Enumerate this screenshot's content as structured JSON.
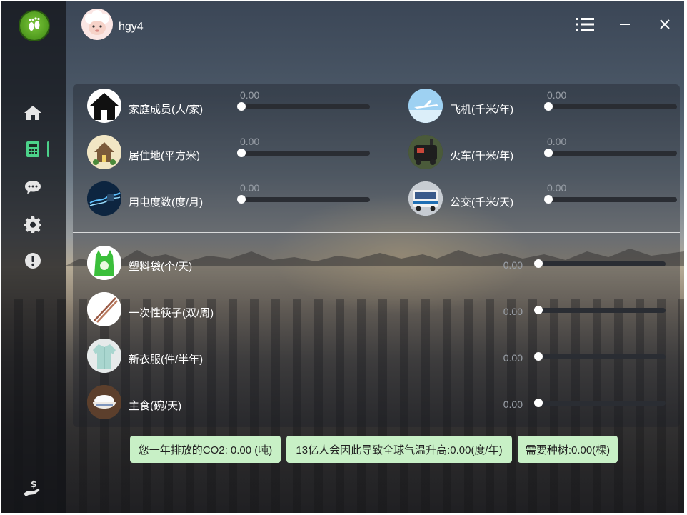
{
  "user": {
    "name": "hgy4"
  },
  "sidebar": {
    "items": [
      {
        "icon": "home-icon"
      },
      {
        "icon": "calculator-icon",
        "active": true
      },
      {
        "icon": "chat-icon"
      },
      {
        "icon": "gear-icon"
      },
      {
        "icon": "alert-icon"
      }
    ],
    "bottom_icon": "donate-icon"
  },
  "topbar": {
    "menu_icon": "list-icon",
    "min_icon": "minimize-icon",
    "close_icon": "close-icon"
  },
  "travel_left": [
    {
      "label": "家庭成员(人/家)",
      "value": "0.00",
      "icon": "house-icon"
    },
    {
      "label": "居住地(平方米)",
      "value": "0.00",
      "icon": "residence-icon"
    },
    {
      "label": "用电度数(度/月)",
      "value": "0.00",
      "icon": "electricity-icon"
    }
  ],
  "travel_right": [
    {
      "label": "飞机(千米/年)",
      "value": "0.00",
      "icon": "airplane-icon"
    },
    {
      "label": "火车(千米/年)",
      "value": "0.00",
      "icon": "train-icon"
    },
    {
      "label": "公交(千米/天)",
      "value": "0.00",
      "icon": "bus-icon"
    }
  ],
  "consumption": [
    {
      "label": "塑料袋(个/天)",
      "value": "0.00",
      "icon": "plastic-bag-icon"
    },
    {
      "label": "一次性筷子(双/周)",
      "value": "0.00",
      "icon": "chopsticks-icon"
    },
    {
      "label": "新衣服(件/半年)",
      "value": "0.00",
      "icon": "clothes-icon"
    },
    {
      "label": "主食(碗/天)",
      "value": "0.00",
      "icon": "rice-bowl-icon"
    }
  ],
  "results": {
    "co2": "您一年排放的CO2: 0.00 (吨)",
    "temperature": "13亿人会因此导致全球气温升高:0.00(度/年)",
    "trees": "需要种树:0.00(棵)"
  },
  "colors": {
    "accent": "#4cd28a",
    "result_bg": "#c8f0c6"
  }
}
